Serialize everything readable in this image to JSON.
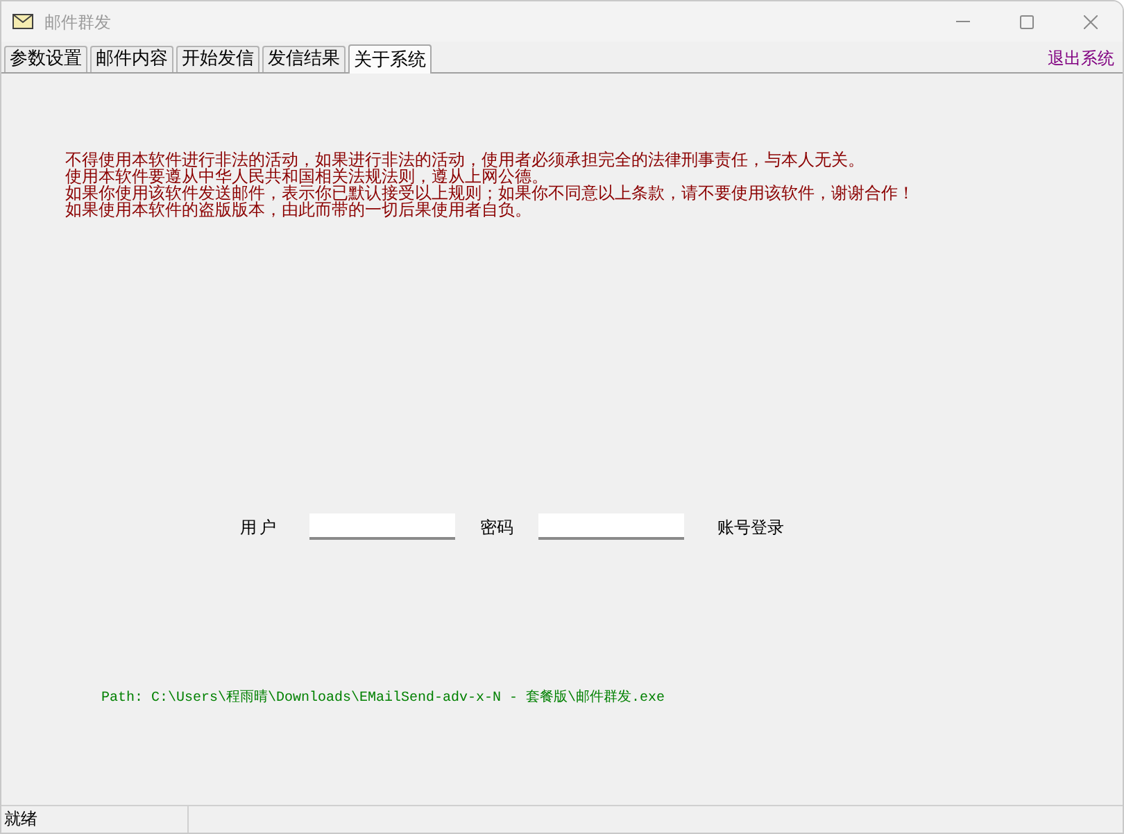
{
  "window": {
    "title": "邮件群发"
  },
  "tabs": [
    {
      "label": "参数设置",
      "selected": false
    },
    {
      "label": "邮件内容",
      "selected": false
    },
    {
      "label": "开始发信",
      "selected": false
    },
    {
      "label": "发信结果",
      "selected": false
    },
    {
      "label": "关于系统",
      "selected": true
    }
  ],
  "exit_link": "退出系统",
  "notice": {
    "lines": [
      "不得使用本软件进行非法的活动，如果进行非法的活动，使用者必须承担完全的法律刑事责任，与本人无关。",
      "使用本软件要遵从中华人民共和国相关法规法则，遵从上网公德。",
      "如果你使用该软件发送邮件，表示你已默认接受以上规则；如果你不同意以上条款，请不要使用该软件，谢谢合作！",
      "如果使用本软件的盗版版本，由此而带的一切后果使用者自负。"
    ]
  },
  "login": {
    "user_label": "用户",
    "password_label": "密码",
    "button": "账号登录"
  },
  "path_text": "Path: C:\\Users\\程雨晴\\Downloads\\EMailSend-adv-x-N - 套餐版\\邮件群发.exe",
  "status_bar": {
    "text": "就绪"
  }
}
